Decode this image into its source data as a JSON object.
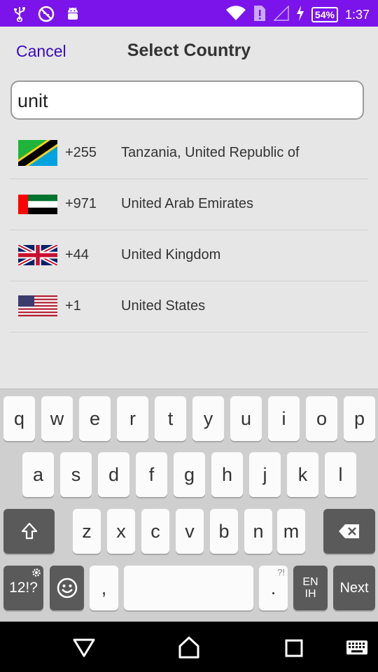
{
  "status_bar": {
    "battery": "54%",
    "time": "1:37",
    "icons_left": [
      "usb-icon",
      "no-sim-icon",
      "android-icon"
    ],
    "icons_right": [
      "wifi-icon",
      "sim-alert-icon",
      "signal-icon",
      "charging-icon"
    ],
    "background": "#7a14ea"
  },
  "header": {
    "cancel": "Cancel",
    "title": "Select Country"
  },
  "search": {
    "value": "unit"
  },
  "countries": [
    {
      "code": "+255",
      "name": "Tanzania, United Republic of",
      "flag": "tanzania-flag"
    },
    {
      "code": "+971",
      "name": "United Arab Emirates",
      "flag": "uae-flag"
    },
    {
      "code": "+44",
      "name": "United Kingdom",
      "flag": "uk-flag"
    },
    {
      "code": "+1",
      "name": "United States",
      "flag": "us-flag"
    }
  ],
  "keyboard": {
    "row1": [
      "q",
      "w",
      "e",
      "r",
      "t",
      "y",
      "u",
      "i",
      "o",
      "p"
    ],
    "row2": [
      "a",
      "s",
      "d",
      "f",
      "g",
      "h",
      "j",
      "k",
      "l"
    ],
    "row3": [
      "z",
      "x",
      "c",
      "v",
      "b",
      "n",
      "m"
    ],
    "symbols": "12!?",
    "comma": ",",
    "period": ".",
    "period_hint": "?!",
    "lang_top": "EN",
    "lang_bottom": "IH",
    "next": "Next"
  },
  "accent_color": "#3a0cb8"
}
